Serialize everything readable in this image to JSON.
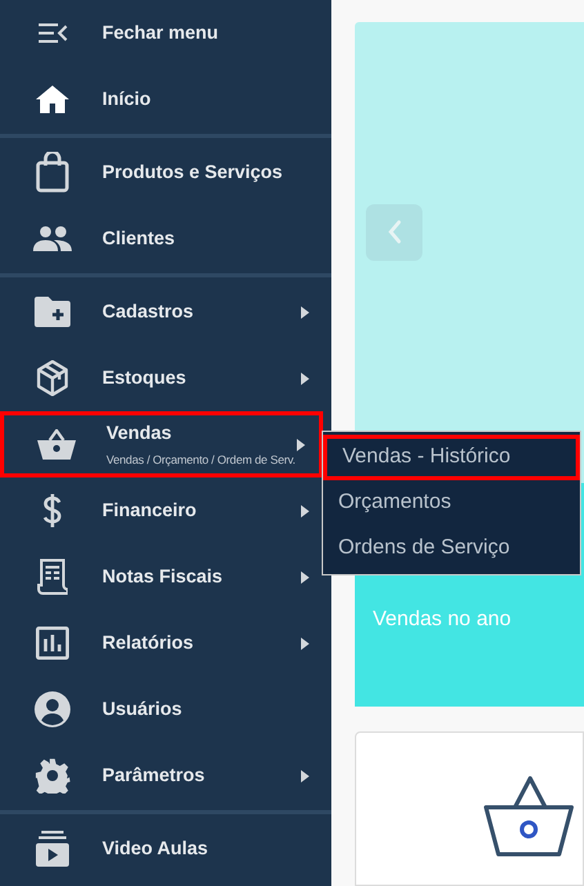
{
  "sidebar": {
    "groups": [
      [
        {
          "label": "Fechar menu",
          "has_submenu": false,
          "highlighted": false
        },
        {
          "label": "Início",
          "has_submenu": false,
          "highlighted": false
        }
      ],
      [
        {
          "label": "Produtos e Serviços",
          "has_submenu": false,
          "highlighted": false
        },
        {
          "label": "Clientes",
          "has_submenu": false,
          "highlighted": false
        }
      ],
      [
        {
          "label": "Cadastros",
          "has_submenu": true,
          "highlighted": false
        },
        {
          "label": "Estoques",
          "has_submenu": true,
          "highlighted": false
        },
        {
          "label": "Vendas",
          "subtitle": "Vendas / Orçamento / Ordem de Serv.",
          "has_submenu": true,
          "highlighted": true
        },
        {
          "label": "Financeiro",
          "has_submenu": true,
          "highlighted": false
        },
        {
          "label": "Notas Fiscais",
          "has_submenu": true,
          "highlighted": false
        },
        {
          "label": "Relatórios",
          "has_submenu": true,
          "highlighted": false
        },
        {
          "label": "Usuários",
          "has_submenu": false,
          "highlighted": false
        },
        {
          "label": "Parâmetros",
          "has_submenu": true,
          "highlighted": false
        }
      ],
      [
        {
          "label": "Video Aulas",
          "has_submenu": false,
          "highlighted": false
        }
      ]
    ]
  },
  "submenu": {
    "items": [
      {
        "label": "Vendas - Histórico",
        "highlighted": true
      },
      {
        "label": "Orçamentos",
        "highlighted": false
      },
      {
        "label": "Ordens de Serviço",
        "highlighted": false
      }
    ]
  },
  "sales_card": {
    "label": "Vendas no ano"
  }
}
